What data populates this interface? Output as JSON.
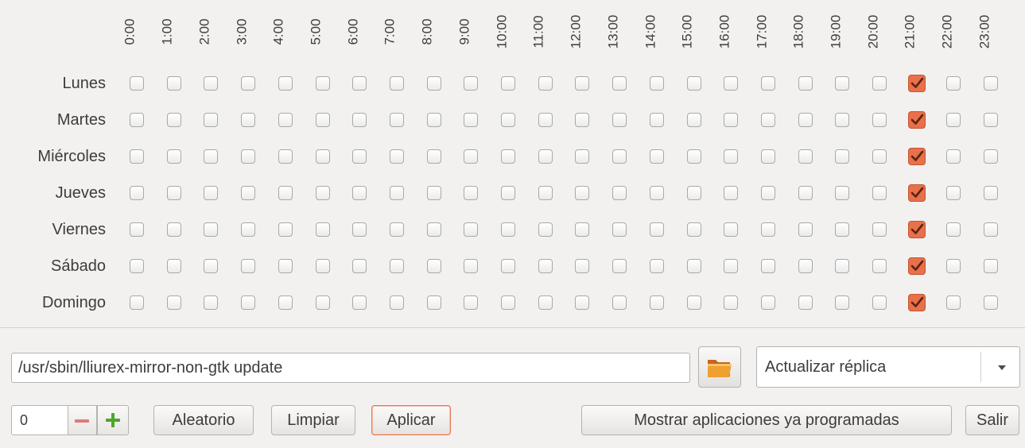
{
  "hours": [
    "0:00",
    "1:00",
    "2:00",
    "3:00",
    "4:00",
    "5:00",
    "6:00",
    "7:00",
    "8:00",
    "9:00",
    "10:00",
    "11:00",
    "12:00",
    "13:00",
    "14:00",
    "15:00",
    "16:00",
    "17:00",
    "18:00",
    "19:00",
    "20:00",
    "21:00",
    "22:00",
    "23:00"
  ],
  "days": [
    "Lunes",
    "Martes",
    "Miércoles",
    "Jueves",
    "Viernes",
    "Sábado",
    "Domingo"
  ],
  "schedule_checked": {
    "Lunes": [
      21
    ],
    "Martes": [
      21
    ],
    "Miércoles": [
      21
    ],
    "Jueves": [
      21
    ],
    "Viernes": [
      21
    ],
    "Sábado": [
      21
    ],
    "Domingo": [
      21
    ]
  },
  "command": {
    "value": "/usr/sbin/lliurex-mirror-non-gtk update"
  },
  "folder_button": {
    "icon": "folder-icon"
  },
  "task_combo": {
    "selected": "Actualizar réplica",
    "icon": "dropdown-arrow-icon"
  },
  "spinner": {
    "value": "0",
    "minus_icon": "minus-icon",
    "plus_icon": "plus-icon"
  },
  "buttons": {
    "random": "Aleatorio",
    "clear": "Limpiar",
    "apply": "Aplicar",
    "show_scheduled": "Mostrar aplicaciones ya programadas",
    "exit": "Salir"
  },
  "colors": {
    "accent": "#e8704a",
    "background": "#f2f1f0",
    "plus_green": "#4aa829",
    "minus_red": "#d94d4d"
  }
}
